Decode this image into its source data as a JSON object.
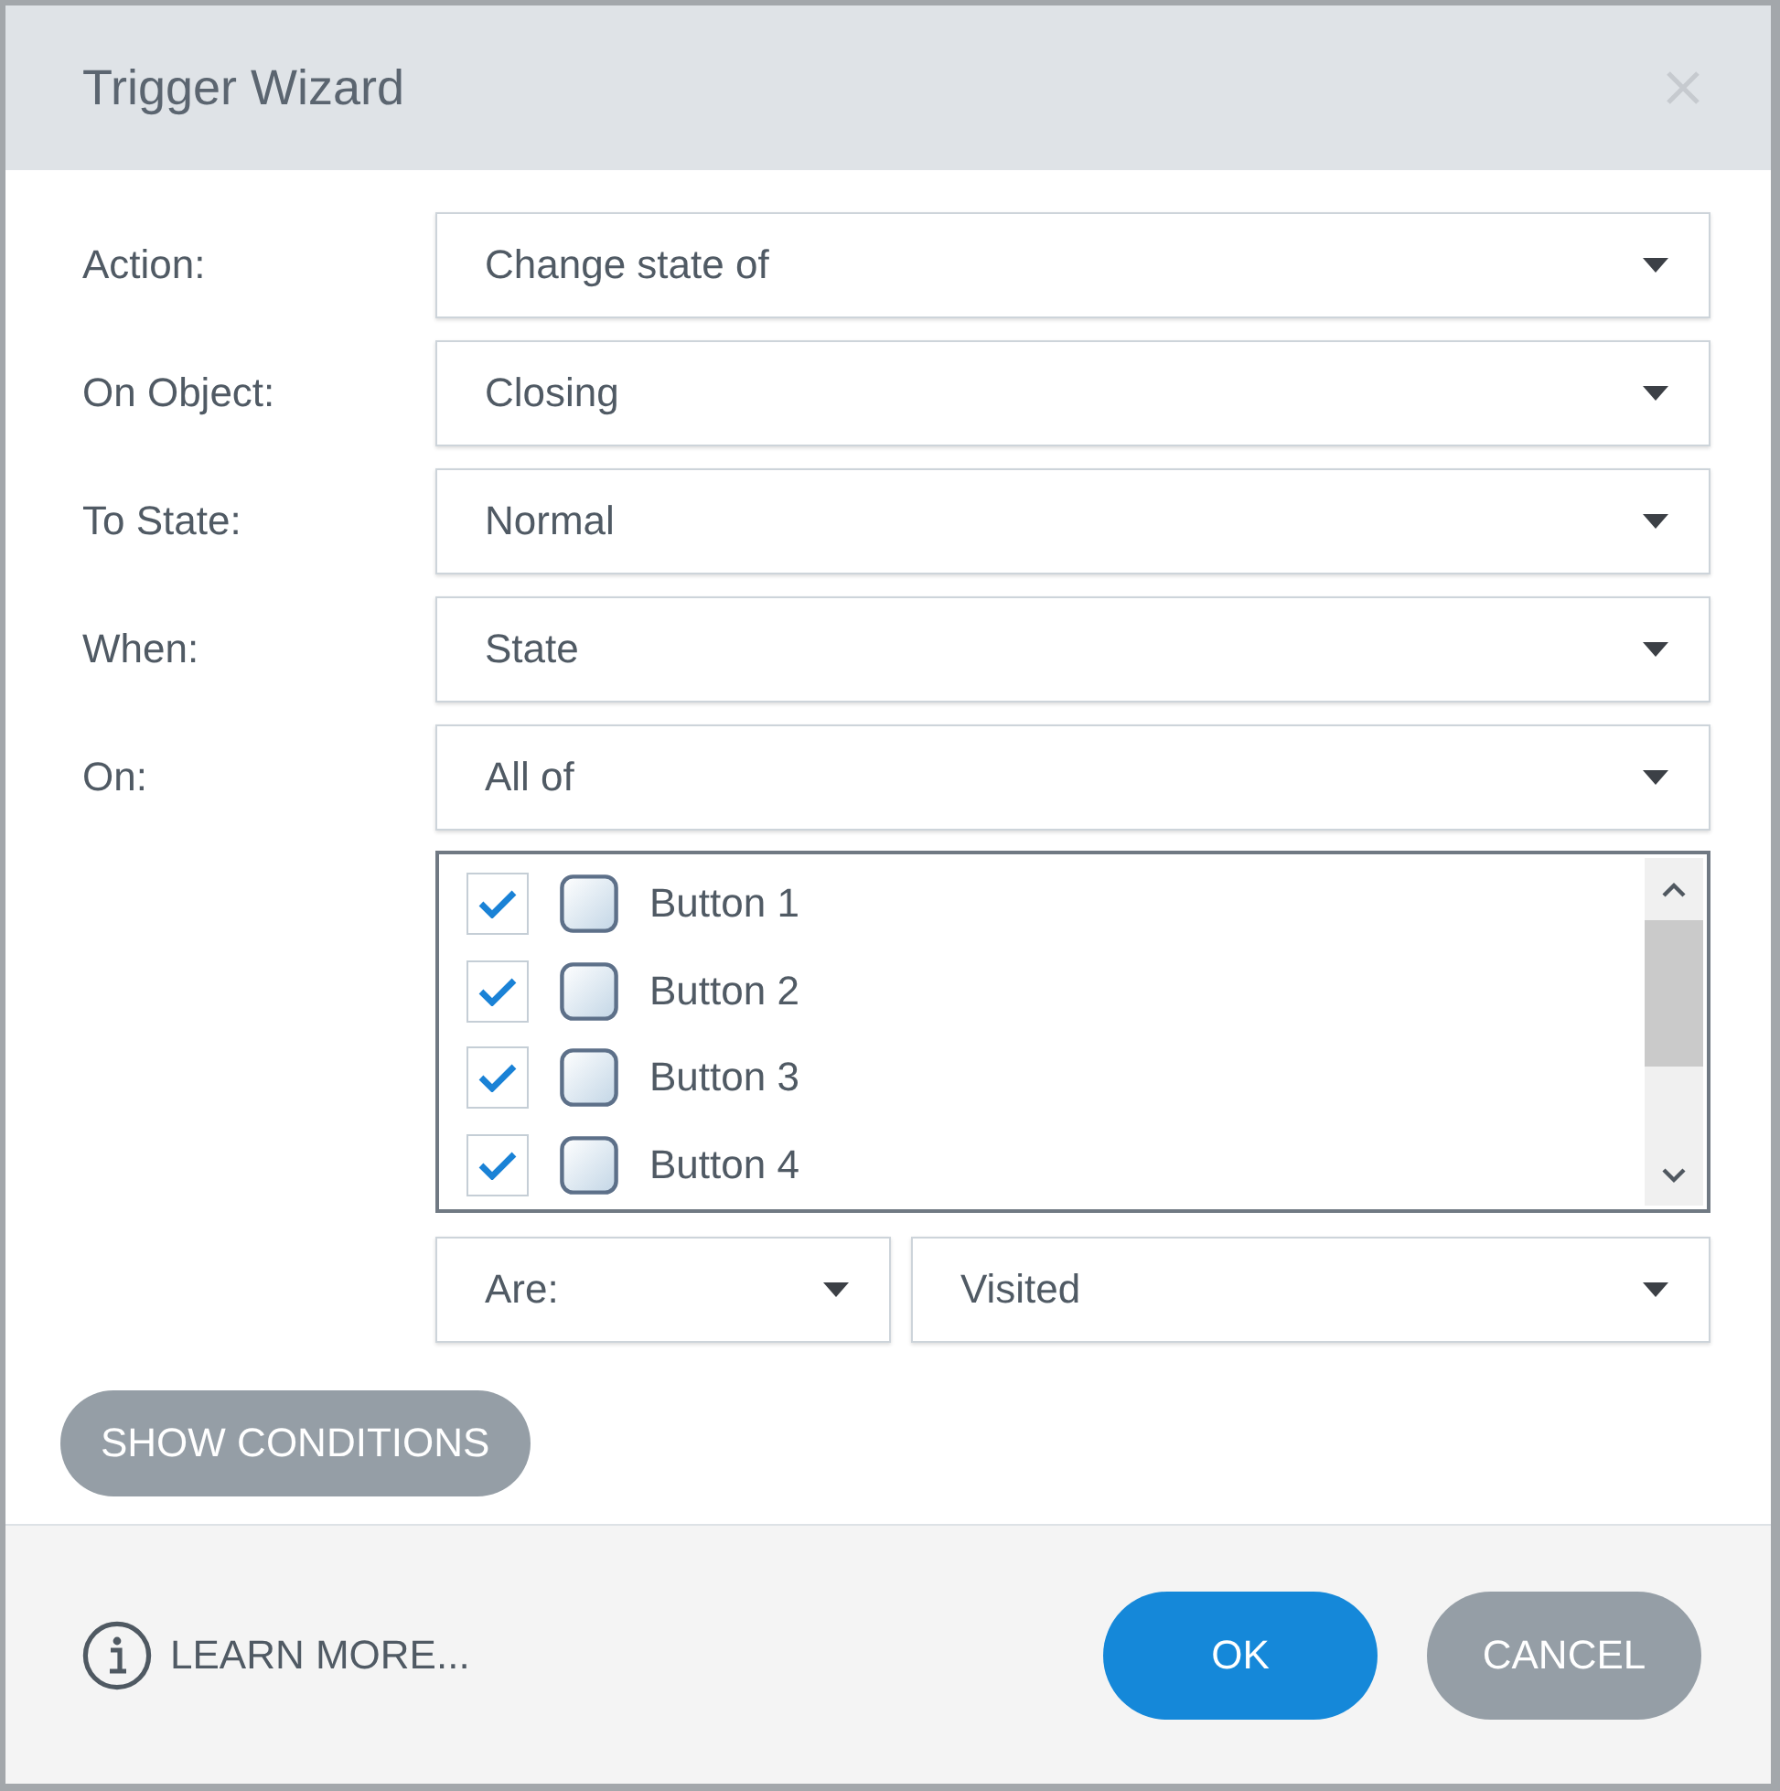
{
  "window": {
    "title": "Trigger Wizard"
  },
  "fields": [
    {
      "label": "Action:",
      "value": "Change state of"
    },
    {
      "label": "On Object:",
      "value": "Closing"
    },
    {
      "label": "To State:",
      "value": "Normal"
    },
    {
      "label": "When:",
      "value": "State"
    },
    {
      "label": "On:",
      "value": "All of"
    }
  ],
  "objects_list": {
    "items": [
      {
        "label": "Button 1",
        "checked": true
      },
      {
        "label": "Button 2",
        "checked": true
      },
      {
        "label": "Button 3",
        "checked": true
      },
      {
        "label": "Button 4",
        "checked": true
      }
    ]
  },
  "conditions": {
    "operator": "Are:",
    "state": "Visited"
  },
  "show_conditions_button": "SHOW CONDITIONS",
  "footer": {
    "learn_more": "LEARN MORE...",
    "buttons": [
      {
        "label": "OK",
        "kind": "primary"
      },
      {
        "label": "CANCEL",
        "kind": "secondary"
      }
    ]
  }
}
